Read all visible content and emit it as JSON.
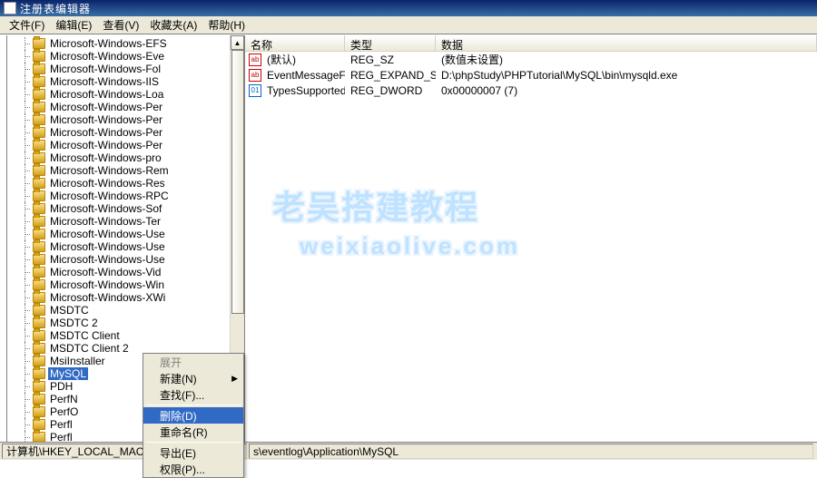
{
  "title": "注册表编辑器",
  "menus": [
    "文件(F)",
    "编辑(E)",
    "查看(V)",
    "收藏夹(A)",
    "帮助(H)"
  ],
  "tree": [
    "Microsoft-Windows-EFS",
    "Microsoft-Windows-Eve",
    "Microsoft-Windows-Fol",
    "Microsoft-Windows-IIS",
    "Microsoft-Windows-Loa",
    "Microsoft-Windows-Per",
    "Microsoft-Windows-Per",
    "Microsoft-Windows-Per",
    "Microsoft-Windows-Per",
    "Microsoft-Windows-pro",
    "Microsoft-Windows-Rem",
    "Microsoft-Windows-Res",
    "Microsoft-Windows-RPC",
    "Microsoft-Windows-Sof",
    "Microsoft-Windows-Ter",
    "Microsoft-Windows-Use",
    "Microsoft-Windows-Use",
    "Microsoft-Windows-Use",
    "Microsoft-Windows-Vid",
    "Microsoft-Windows-Win",
    "Microsoft-Windows-XWi",
    "MSDTC",
    "MSDTC 2",
    "MSDTC Client",
    "MSDTC Client 2",
    "MsiInstaller",
    "MySQL",
    "PDH",
    "PerfN",
    "PerfO",
    "Perfl",
    "Perfl"
  ],
  "selected_tree_index": 26,
  "columns": [
    "名称",
    "类型",
    "数据"
  ],
  "rows": [
    {
      "icon": "str",
      "name": "(默认)",
      "type": "REG_SZ",
      "data": "(数值未设置)"
    },
    {
      "icon": "str",
      "name": "EventMessageFile",
      "type": "REG_EXPAND_SZ",
      "data": "D:\\phpStudy\\PHPTutorial\\MySQL\\bin\\mysqld.exe"
    },
    {
      "icon": "bin",
      "name": "TypesSupported",
      "type": "REG_DWORD",
      "data": "0x00000007 (7)"
    }
  ],
  "context_menu": [
    {
      "label": "展开",
      "kind": "disabled"
    },
    {
      "label": "新建(N)",
      "kind": "submenu"
    },
    {
      "label": "查找(F)...",
      "kind": "item"
    },
    {
      "kind": "sep"
    },
    {
      "label": "删除(D)",
      "kind": "hover"
    },
    {
      "label": "重命名(R)",
      "kind": "item"
    },
    {
      "kind": "sep"
    },
    {
      "label": "导出(E)",
      "kind": "item"
    },
    {
      "label": "权限(P)...",
      "kind": "item"
    }
  ],
  "status_left": "计算机\\HKEY_LOCAL_MACHINE\\SYSTEM\\C",
  "status_right": "s\\eventlog\\Application\\MySQL",
  "watermark1": "老吴搭建教程",
  "watermark2": "weixiaolive.com"
}
